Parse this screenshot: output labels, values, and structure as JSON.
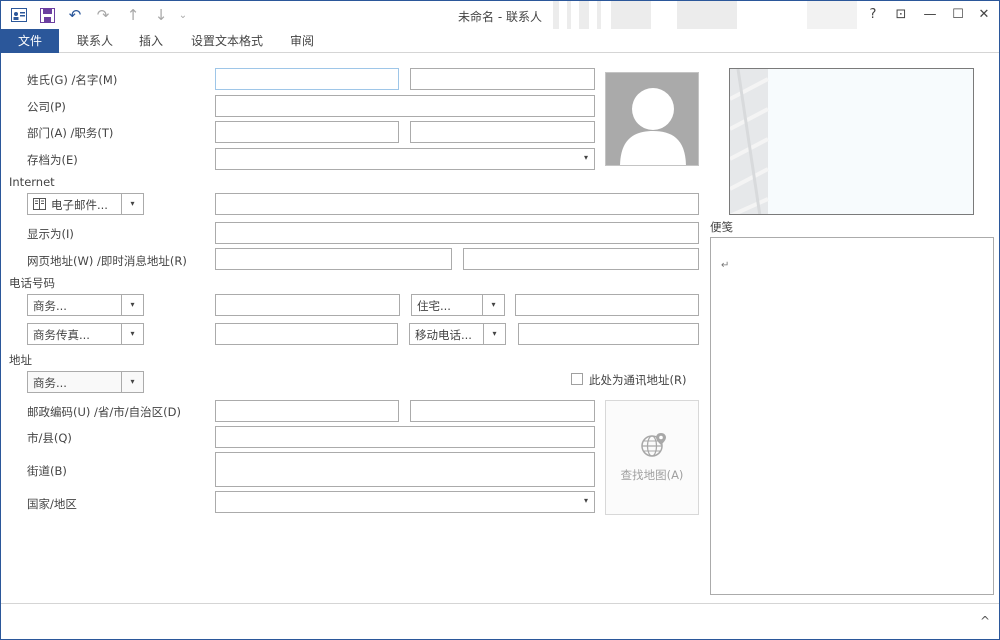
{
  "window": {
    "title": "未命名 - 联系人",
    "help": "?",
    "ribbon_display": "⊡",
    "minimize": "—",
    "maximize": "☐",
    "close": "✕"
  },
  "qat": {
    "undo": "↶",
    "redo": "↷",
    "up": "↑",
    "down": "↓",
    "customize": "₹"
  },
  "ribbon": {
    "tabs": [
      "文件",
      "联系人",
      "插入",
      "设置文本格式",
      "审阅"
    ]
  },
  "form": {
    "name_label": "姓氏(G)  /名字(M)",
    "company_label": "公司(P)",
    "dept_label": "部门(A)  /职务(T)",
    "file_as_label": "存档为(E)",
    "internet_section": "Internet",
    "email_button": "电子邮件...",
    "display_as_label": "显示为(I)",
    "web_label": "网页地址(W)  /即时消息地址(R)",
    "phone_section": "电话号码",
    "phone1_label": "商务...",
    "phone2_label": "住宅...",
    "phone3_label": "商务传真...",
    "phone4_label": "移动电话...",
    "address_section": "地址",
    "address_type": "商务...",
    "mailing_address_label": "此处为通讯地址(R)",
    "postal_label": "邮政编码(U)  /省/市/自治区(D)",
    "city_label": "市/县(Q)",
    "street_label": "街道(B)",
    "country_label": "国家/地区",
    "map_button": "查找地图(A)"
  },
  "notes": {
    "label": "便笺",
    "content": "↵"
  },
  "status": {
    "expand": "^"
  }
}
